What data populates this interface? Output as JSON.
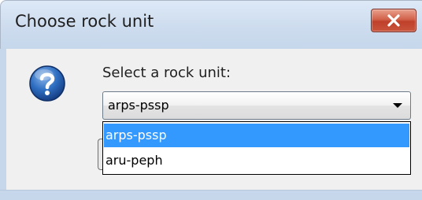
{
  "window": {
    "title": "Choose rock unit",
    "close_icon": "close-icon"
  },
  "dialog": {
    "icon": "question-icon",
    "prompt": "Select a rock unit:",
    "combo": {
      "value": "arps-pssp",
      "arrow_icon": "chevron-down-icon"
    },
    "dropdown": {
      "options": [
        {
          "label": "arps-pssp",
          "selected": true
        },
        {
          "label": "aru-peph",
          "selected": false
        }
      ]
    }
  },
  "colors": {
    "selection": "#3399ff",
    "titlebar": "#c6d7eb",
    "close_button": "#c9553c"
  }
}
